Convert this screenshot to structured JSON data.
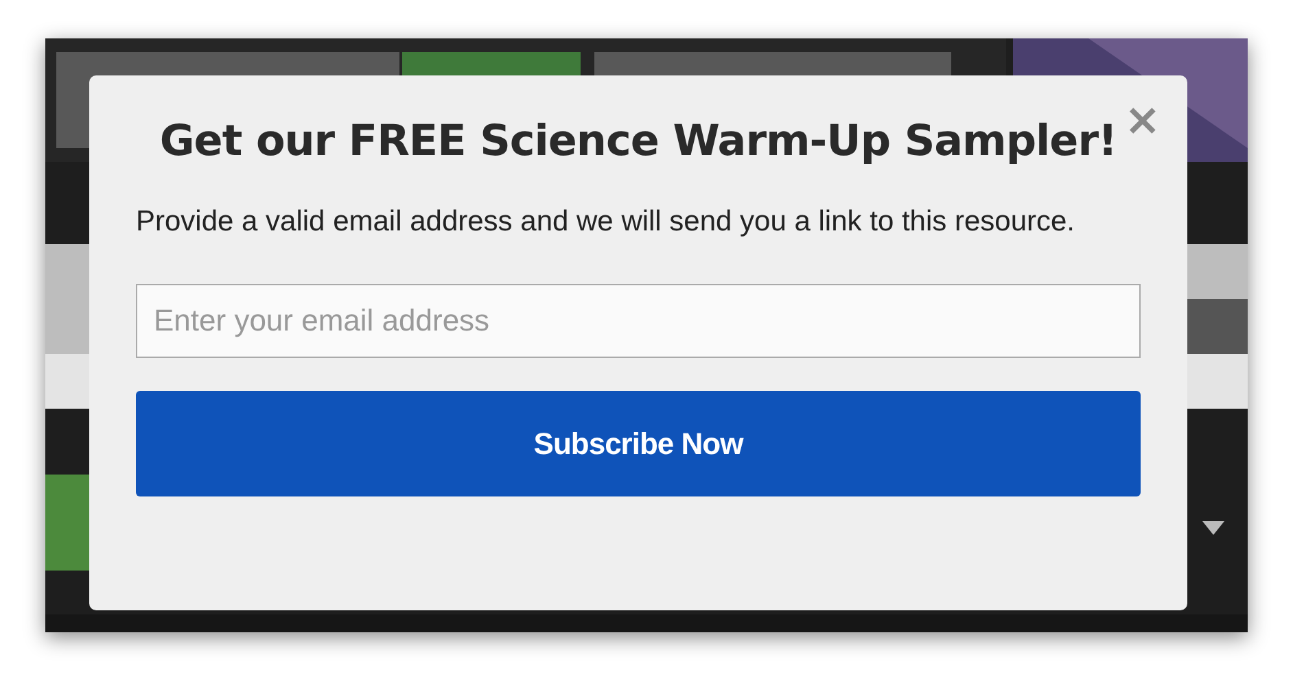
{
  "modal": {
    "close": "×",
    "title": "Get our FREE Science Warm-Up Sampler!",
    "message": "Provide a valid email address and we will send you a link to this resource.",
    "email_field": {
      "placeholder": "Enter your email address"
    },
    "submit_button": "Subscribe Now"
  }
}
